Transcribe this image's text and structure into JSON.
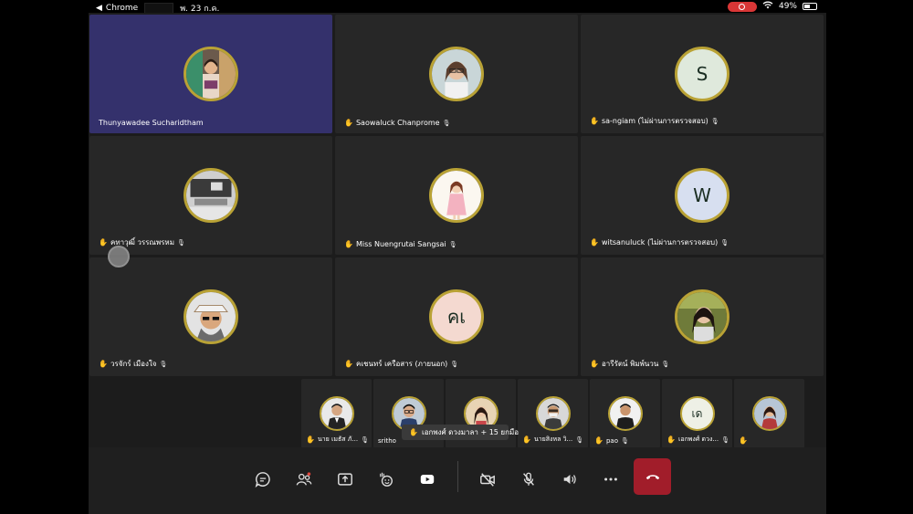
{
  "status_bar": {
    "back_app": "Chrome",
    "date": "พ. 23 ก.ค.",
    "battery": "49%",
    "battery_level": 0.49
  },
  "colors": {
    "active_tile": "#34316c",
    "tile_bg": "#272727",
    "avatar_ring": "#b9a235",
    "leave_button": "#a11d2a",
    "hand_icon": "#e0b800"
  },
  "main_tiles": [
    {
      "name": "Thunyawadee Sucharidtham",
      "avatar": "photo-woman-colorful",
      "hand": false,
      "muted": false,
      "active": true
    },
    {
      "name": "Saowaluck  Chanprome",
      "avatar": "photo-woman-glasses",
      "hand": true,
      "muted": true
    },
    {
      "name": "sa-ngiam (ไม่ผ่านการตรวจสอบ)",
      "avatar": "initial",
      "initial": "S",
      "avatar_bg": "#dfe9dc",
      "hand": true,
      "muted": true
    },
    {
      "name": "คทาวุฒิ์ วรรณพรหม",
      "avatar": "photo-desk",
      "hand": true,
      "muted": true
    },
    {
      "name": "Miss Nuengrutai  Sangsai",
      "avatar": "photo-cartoon-girl",
      "hand": true,
      "muted": true
    },
    {
      "name": "witsanuluck (ไม่ผ่านการตรวจสอบ)",
      "avatar": "initial",
      "initial": "W",
      "avatar_bg": "#d7dff0",
      "hand": true,
      "muted": true
    },
    {
      "name": "วรจักร์  เมืองใจ",
      "avatar": "photo-man-hat",
      "hand": true,
      "muted": true
    },
    {
      "name": "คเชนทร์ เครือสาร (ภายนอก)",
      "avatar": "initial",
      "initial": "คเ",
      "avatar_bg": "#f4d9d0",
      "hand": true,
      "muted": true
    },
    {
      "name": "อารีรัตน์ พิมพ์นวน",
      "avatar": "photo-woman-outdoor",
      "hand": true,
      "muted": true
    }
  ],
  "small_tiles": [
    {
      "name": "นาย เมธัส  ภั...",
      "avatar": "photo-man-suit",
      "hand": true,
      "muted": true
    },
    {
      "name": "sritho",
      "avatar": "photo-man-glasses",
      "hand": false,
      "muted": false
    },
    {
      "name": "",
      "avatar": "photo-woman-hair",
      "hand": false,
      "muted": false
    },
    {
      "name": "นายสิงหล  วิ...",
      "avatar": "photo-man-mask",
      "hand": true,
      "muted": true
    },
    {
      "name": "pao",
      "avatar": "photo-man-dark",
      "hand": true,
      "muted": true
    },
    {
      "name": "เอกพงศ์  ดวง...",
      "avatar": "initial",
      "initial": "เด",
      "avatar_bg": "#eef0e6",
      "hand": true,
      "muted": true
    },
    {
      "name": "",
      "avatar": "photo-woman-red",
      "hand": true,
      "muted": false
    }
  ],
  "toast": {
    "text": "เอกพงศ์ ดวงมาลา + 15 ยกมือ",
    "icon": "raised-hand-icon"
  },
  "toolbar": {
    "buttons": [
      "chat-icon",
      "people-icon",
      "share-screen-icon",
      "reactions-icon",
      "youtube-icon",
      "camera-off-icon",
      "mic-off-icon",
      "speaker-icon",
      "more-icon"
    ],
    "leave_icon": "hang-up-icon"
  }
}
